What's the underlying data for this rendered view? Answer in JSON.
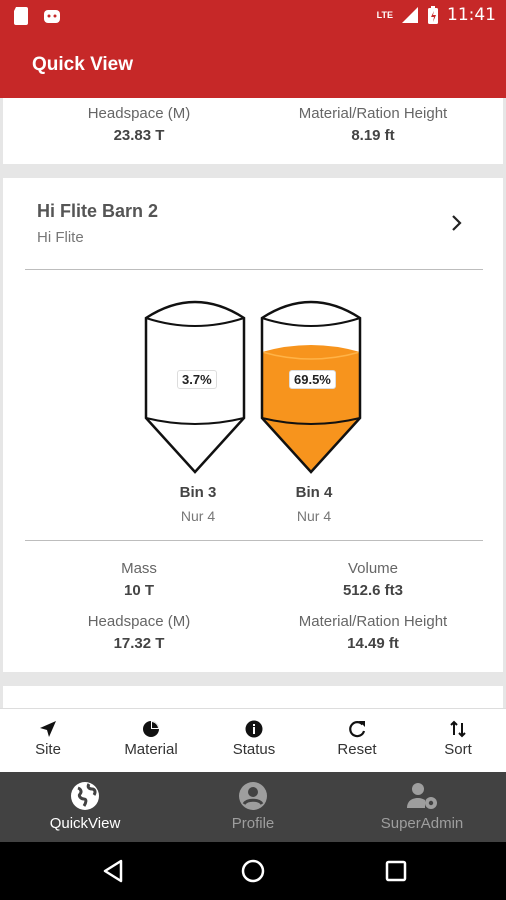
{
  "status_bar": {
    "time": "11:41",
    "network": "LTE"
  },
  "app_bar": {
    "title": "Quick View"
  },
  "card_top": {
    "headspace_label": "Headspace (M)",
    "headspace_value": "23.83 T",
    "height_label": "Material/Ration Height",
    "height_value": "8.19 ft"
  },
  "site": {
    "name": "Hi Flite Barn 2",
    "subtitle": "Hi Flite",
    "bins": [
      {
        "name": "Bin 3",
        "sub": "Nur 4",
        "percent": "3.7%",
        "fill": 0.037,
        "color": "#ffffff"
      },
      {
        "name": "Bin 4",
        "sub": "Nur 4",
        "percent": "69.5%",
        "fill": 0.695,
        "color": "#f7941d"
      }
    ],
    "stats": {
      "mass_label": "Mass",
      "mass_value": "10 T",
      "volume_label": "Volume",
      "volume_value": "512.6 ft3",
      "headspace_label": "Headspace (M)",
      "headspace_value": "17.32 T",
      "height_label": "Material/Ration Height",
      "height_value": "14.49 ft"
    }
  },
  "toolbar": {
    "items": [
      {
        "label": "Site",
        "icon": "navigation-arrow-icon"
      },
      {
        "label": "Material",
        "icon": "pie-chart-icon"
      },
      {
        "label": "Status",
        "icon": "info-icon"
      },
      {
        "label": "Reset",
        "icon": "refresh-icon"
      },
      {
        "label": "Sort",
        "icon": "sort-icon"
      }
    ]
  },
  "bottom_nav": {
    "items": [
      {
        "label": "QuickView",
        "icon": "globe-icon",
        "active": true
      },
      {
        "label": "Profile",
        "icon": "account-circle-icon",
        "active": false
      },
      {
        "label": "SuperAdmin",
        "icon": "admin-user-gear-icon",
        "active": false
      }
    ]
  },
  "colors": {
    "primary": "#c62828",
    "bin_fill": "#f7941d",
    "nav_bg": "#424242"
  }
}
